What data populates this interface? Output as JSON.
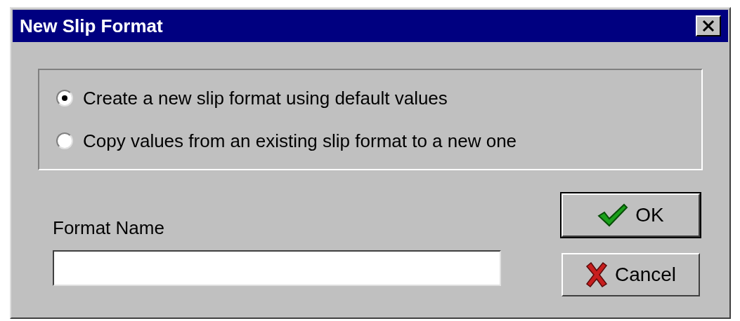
{
  "window": {
    "title": "New Slip Format"
  },
  "options": [
    {
      "label": "Create a new slip format using default values",
      "selected": true
    },
    {
      "label": "Copy values from an existing slip format to a new one",
      "selected": false
    }
  ],
  "field": {
    "label": "Format Name"
  },
  "buttons": [
    {
      "label": "OK",
      "kind": "ok"
    },
    {
      "label": "Cancel",
      "kind": "cancel"
    }
  ]
}
